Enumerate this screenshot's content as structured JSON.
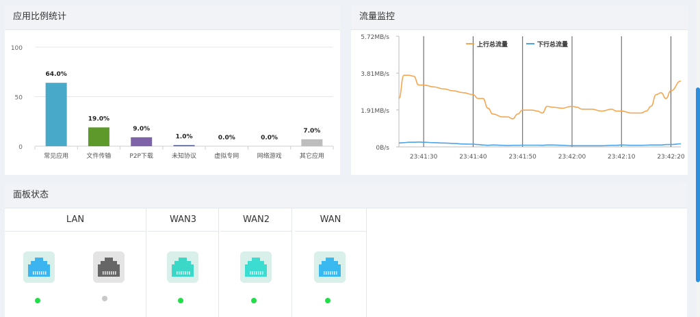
{
  "app_stats": {
    "title": "应用比例统计",
    "y_ticks": [
      "100",
      "50",
      "0"
    ]
  },
  "traffic": {
    "title": "流量监控",
    "y_ticks": [
      "5.72MB/s",
      "3.81MB/s",
      "1.91MB/s",
      "0B/s"
    ],
    "x_ticks": [
      "23:41:30",
      "23:41:40",
      "23:41:50",
      "23:42:00",
      "23:42:10",
      "23:42:20"
    ],
    "legend_up": "上行总流量",
    "legend_down": "下行总流量",
    "colors": {
      "up": "#f5a650",
      "down": "#4da3e8"
    }
  },
  "panel": {
    "title": "面板状态",
    "groups": [
      {
        "name": "LAN"
      },
      {
        "name": "WAN3"
      },
      {
        "name": "WAN2"
      },
      {
        "name": "WAN"
      }
    ]
  },
  "chart_data": [
    {
      "type": "bar",
      "title": "应用比例统计",
      "categories": [
        "常见应用",
        "文件传输",
        "P2P下载",
        "未知协议",
        "虚拟专网",
        "网络游戏",
        "其它应用"
      ],
      "values": [
        64.0,
        19.0,
        9.0,
        1.0,
        0.0,
        0.0,
        7.0
      ],
      "labels": [
        "64.0%",
        "19.0%",
        "9.0%",
        "1.0%",
        "0.0%",
        "0.0%",
        "7.0%"
      ],
      "colors": [
        "#48a9c9",
        "#5e9a2b",
        "#7e63a8",
        "#3f55b5",
        "#cccccc",
        "#cccccc",
        "#bdbdbd"
      ],
      "ylim": [
        0,
        100
      ],
      "grid": true
    },
    {
      "type": "line",
      "title": "流量监控",
      "x": [
        "23:41:25",
        "23:41:26",
        "23:41:27",
        "23:41:28",
        "23:41:29",
        "23:41:30",
        "23:41:32",
        "23:41:34",
        "23:41:36",
        "23:41:38",
        "23:41:40",
        "23:41:41",
        "23:41:42",
        "23:41:43",
        "23:41:44",
        "23:41:46",
        "23:41:47",
        "23:41:48",
        "23:41:49",
        "23:41:50",
        "23:41:52",
        "23:41:53",
        "23:41:54",
        "23:41:55",
        "23:41:56",
        "23:41:58",
        "23:42:00",
        "23:42:01",
        "23:42:02",
        "23:42:04",
        "23:42:06",
        "23:42:08",
        "23:42:09",
        "23:42:10",
        "23:42:12",
        "23:42:14",
        "23:42:15",
        "23:42:16",
        "23:42:17",
        "23:42:18",
        "23:42:19",
        "23:42:20",
        "23:42:22"
      ],
      "series": [
        {
          "name": "上行总流量",
          "values": [
            2.5,
            3.7,
            3.7,
            3.65,
            3.2,
            3.2,
            3.1,
            3.0,
            2.9,
            2.8,
            2.7,
            2.5,
            2.5,
            2.0,
            1.7,
            1.55,
            1.55,
            1.45,
            1.7,
            1.9,
            1.9,
            1.85,
            1.75,
            2.1,
            2.05,
            2.0,
            2.1,
            2.05,
            1.95,
            1.95,
            1.85,
            1.95,
            1.85,
            1.85,
            1.75,
            1.75,
            1.85,
            2.1,
            2.7,
            2.8,
            2.5,
            2.9,
            3.4
          ]
        },
        {
          "name": "下行总流量",
          "values": [
            0.2,
            0.22,
            0.24,
            0.24,
            0.25,
            0.24,
            0.22,
            0.2,
            0.18,
            0.15,
            0.14,
            0.12,
            0.1,
            0.08,
            0.1,
            0.08,
            0.07,
            0.08,
            0.08,
            0.09,
            0.09,
            0.09,
            0.08,
            0.1,
            0.1,
            0.08,
            0.06,
            0.06,
            0.06,
            0.06,
            0.06,
            0.08,
            0.08,
            0.1,
            0.08,
            0.08,
            0.09,
            0.1,
            0.1,
            0.1,
            0.12,
            0.12,
            0.16
          ]
        }
      ],
      "ylim": [
        0,
        5.72
      ],
      "y_unit": "MB/s"
    }
  ],
  "ports": [
    {
      "group": 0,
      "status": "connected",
      "color": "#3cb4ef",
      "dot": "#22dd4a"
    },
    {
      "group": 0,
      "status": "disconnected",
      "color": "#666666",
      "dot": "#c8c8c8"
    },
    {
      "group": 1,
      "status": "connected",
      "color": "#3bd8c8",
      "dot": "#22dd4a"
    },
    {
      "group": 2,
      "status": "connected",
      "color": "#3cddd0",
      "dot": "#22dd4a"
    },
    {
      "group": 3,
      "status": "connected",
      "color": "#3ab8f0",
      "dot": "#22dd4a"
    }
  ]
}
